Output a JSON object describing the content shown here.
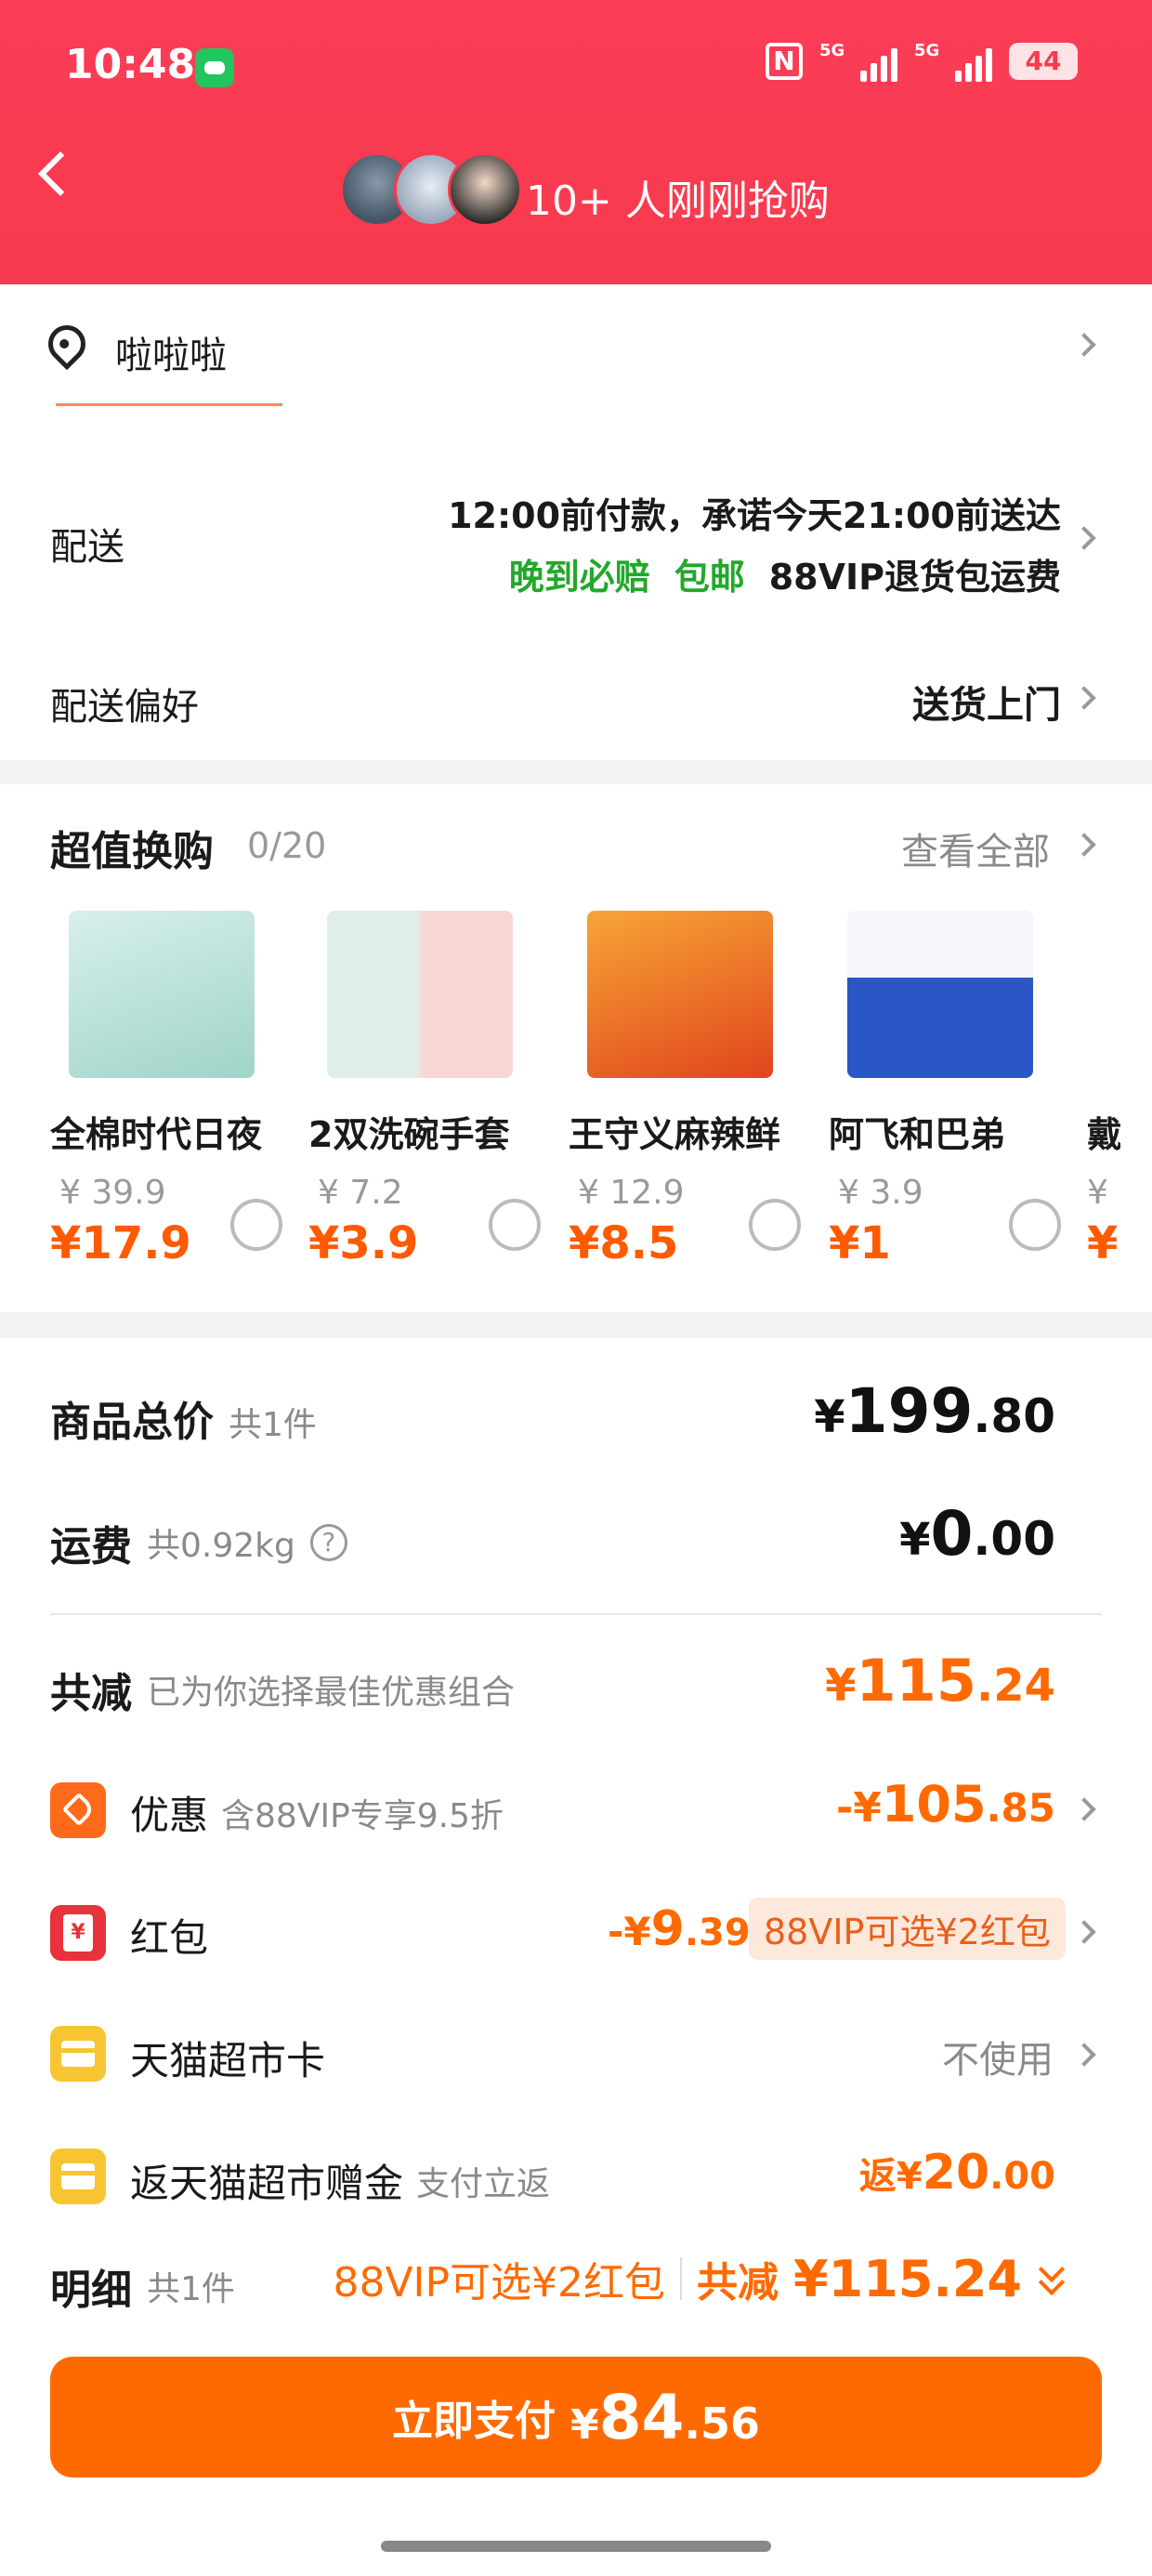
{
  "status_bar": {
    "time": "10:48",
    "nfc": "N",
    "net1": "5G",
    "net2": "5G",
    "battery": "44"
  },
  "header": {
    "buyers_text": "10+ 人刚刚抢购"
  },
  "address": {
    "name": "啦啦啦"
  },
  "delivery": {
    "label": "配送",
    "line1": "12:00前付款，承诺今天21:00前送达",
    "tags": [
      "晚到必赔",
      "包邮",
      "88VIP退货包运费"
    ]
  },
  "delivery_pref": {
    "label": "配送偏好",
    "value": "送货上门"
  },
  "swap": {
    "title": "超值换购",
    "count": "0/20",
    "see_all": "查看全部",
    "products": [
      {
        "name": "全棉时代日夜",
        "old_price": "¥ 39.9",
        "new_price": "¥17.9",
        "color": "#bfe3dc"
      },
      {
        "name": "2双洗碗手套",
        "old_price": "¥ 7.2",
        "new_price": "¥3.9",
        "color": "#e9eef0"
      },
      {
        "name": "王守义麻辣鲜",
        "old_price": "¥ 12.9",
        "new_price": "¥8.5",
        "color": "#f08a1e"
      },
      {
        "name": "阿飞和巴弟",
        "old_price": "¥ 3.9",
        "new_price": "¥1",
        "color": "#2a56c6"
      },
      {
        "name": "戴",
        "old_price": "¥",
        "new_price": "¥",
        "color": "#dddddd"
      }
    ]
  },
  "summary": {
    "goods_total": {
      "label": "商品总价",
      "sub": "共1件",
      "currency": "¥",
      "int": "199",
      "dec": ".80"
    },
    "shipping": {
      "label": "运费",
      "sub": "共0.92kg",
      "currency": "¥",
      "int": "0",
      "dec": ".00"
    },
    "discount": {
      "label": "共减",
      "sub": "已为你选择最佳优惠组合",
      "currency": "¥",
      "int": "115",
      "dec": ".24"
    },
    "coupon": {
      "label": "优惠",
      "sub": "含88VIP专享9.5折",
      "prefix": "-¥",
      "int": "105",
      "dec": ".85"
    },
    "redpacket": {
      "label": "红包",
      "prefix": "-¥",
      "int": "9",
      "dec": ".39",
      "pill": "88VIP可选¥2红包"
    },
    "market_card": {
      "label": "天猫超市卡",
      "value": "不使用"
    },
    "rebate": {
      "label": "返天猫超市赠金",
      "sub": "支付立返",
      "prefix": "返¥",
      "int": "20",
      "dec": ".00"
    },
    "detail": {
      "label": "明细",
      "sub": "共1件",
      "vip_text": "88VIP可选¥2红包",
      "total_label": "共减",
      "total_value": "¥115.24"
    }
  },
  "pay": {
    "label": "立即支付",
    "currency": "¥",
    "int": "84",
    "dec": ".56"
  },
  "colors": {
    "header": "#f83a4e",
    "accent": "#ff6a00",
    "green": "#22a82a"
  }
}
